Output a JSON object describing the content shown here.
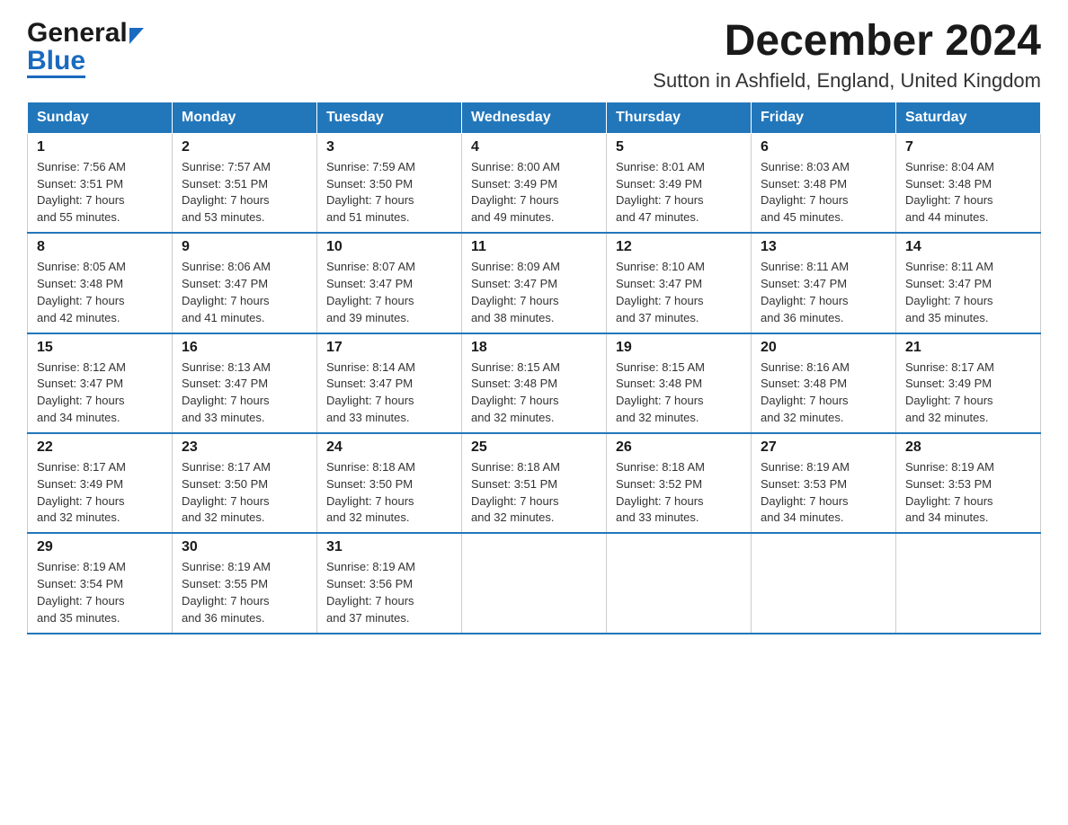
{
  "logo": {
    "general": "General",
    "blue": "Blue"
  },
  "header": {
    "title": "December 2024",
    "subtitle": "Sutton in Ashfield, England, United Kingdom"
  },
  "days_of_week": [
    "Sunday",
    "Monday",
    "Tuesday",
    "Wednesday",
    "Thursday",
    "Friday",
    "Saturday"
  ],
  "weeks": [
    [
      {
        "day": "1",
        "sunrise": "7:56 AM",
        "sunset": "3:51 PM",
        "daylight": "7 hours and 55 minutes."
      },
      {
        "day": "2",
        "sunrise": "7:57 AM",
        "sunset": "3:51 PM",
        "daylight": "7 hours and 53 minutes."
      },
      {
        "day": "3",
        "sunrise": "7:59 AM",
        "sunset": "3:50 PM",
        "daylight": "7 hours and 51 minutes."
      },
      {
        "day": "4",
        "sunrise": "8:00 AM",
        "sunset": "3:49 PM",
        "daylight": "7 hours and 49 minutes."
      },
      {
        "day": "5",
        "sunrise": "8:01 AM",
        "sunset": "3:49 PM",
        "daylight": "7 hours and 47 minutes."
      },
      {
        "day": "6",
        "sunrise": "8:03 AM",
        "sunset": "3:48 PM",
        "daylight": "7 hours and 45 minutes."
      },
      {
        "day": "7",
        "sunrise": "8:04 AM",
        "sunset": "3:48 PM",
        "daylight": "7 hours and 44 minutes."
      }
    ],
    [
      {
        "day": "8",
        "sunrise": "8:05 AM",
        "sunset": "3:48 PM",
        "daylight": "7 hours and 42 minutes."
      },
      {
        "day": "9",
        "sunrise": "8:06 AM",
        "sunset": "3:47 PM",
        "daylight": "7 hours and 41 minutes."
      },
      {
        "day": "10",
        "sunrise": "8:07 AM",
        "sunset": "3:47 PM",
        "daylight": "7 hours and 39 minutes."
      },
      {
        "day": "11",
        "sunrise": "8:09 AM",
        "sunset": "3:47 PM",
        "daylight": "7 hours and 38 minutes."
      },
      {
        "day": "12",
        "sunrise": "8:10 AM",
        "sunset": "3:47 PM",
        "daylight": "7 hours and 37 minutes."
      },
      {
        "day": "13",
        "sunrise": "8:11 AM",
        "sunset": "3:47 PM",
        "daylight": "7 hours and 36 minutes."
      },
      {
        "day": "14",
        "sunrise": "8:11 AM",
        "sunset": "3:47 PM",
        "daylight": "7 hours and 35 minutes."
      }
    ],
    [
      {
        "day": "15",
        "sunrise": "8:12 AM",
        "sunset": "3:47 PM",
        "daylight": "7 hours and 34 minutes."
      },
      {
        "day": "16",
        "sunrise": "8:13 AM",
        "sunset": "3:47 PM",
        "daylight": "7 hours and 33 minutes."
      },
      {
        "day": "17",
        "sunrise": "8:14 AM",
        "sunset": "3:47 PM",
        "daylight": "7 hours and 33 minutes."
      },
      {
        "day": "18",
        "sunrise": "8:15 AM",
        "sunset": "3:48 PM",
        "daylight": "7 hours and 32 minutes."
      },
      {
        "day": "19",
        "sunrise": "8:15 AM",
        "sunset": "3:48 PM",
        "daylight": "7 hours and 32 minutes."
      },
      {
        "day": "20",
        "sunrise": "8:16 AM",
        "sunset": "3:48 PM",
        "daylight": "7 hours and 32 minutes."
      },
      {
        "day": "21",
        "sunrise": "8:17 AM",
        "sunset": "3:49 PM",
        "daylight": "7 hours and 32 minutes."
      }
    ],
    [
      {
        "day": "22",
        "sunrise": "8:17 AM",
        "sunset": "3:49 PM",
        "daylight": "7 hours and 32 minutes."
      },
      {
        "day": "23",
        "sunrise": "8:17 AM",
        "sunset": "3:50 PM",
        "daylight": "7 hours and 32 minutes."
      },
      {
        "day": "24",
        "sunrise": "8:18 AM",
        "sunset": "3:50 PM",
        "daylight": "7 hours and 32 minutes."
      },
      {
        "day": "25",
        "sunrise": "8:18 AM",
        "sunset": "3:51 PM",
        "daylight": "7 hours and 32 minutes."
      },
      {
        "day": "26",
        "sunrise": "8:18 AM",
        "sunset": "3:52 PM",
        "daylight": "7 hours and 33 minutes."
      },
      {
        "day": "27",
        "sunrise": "8:19 AM",
        "sunset": "3:53 PM",
        "daylight": "7 hours and 34 minutes."
      },
      {
        "day": "28",
        "sunrise": "8:19 AM",
        "sunset": "3:53 PM",
        "daylight": "7 hours and 34 minutes."
      }
    ],
    [
      {
        "day": "29",
        "sunrise": "8:19 AM",
        "sunset": "3:54 PM",
        "daylight": "7 hours and 35 minutes."
      },
      {
        "day": "30",
        "sunrise": "8:19 AM",
        "sunset": "3:55 PM",
        "daylight": "7 hours and 36 minutes."
      },
      {
        "day": "31",
        "sunrise": "8:19 AM",
        "sunset": "3:56 PM",
        "daylight": "7 hours and 37 minutes."
      },
      null,
      null,
      null,
      null
    ]
  ],
  "labels": {
    "sunrise": "Sunrise:",
    "sunset": "Sunset:",
    "daylight": "Daylight:"
  }
}
